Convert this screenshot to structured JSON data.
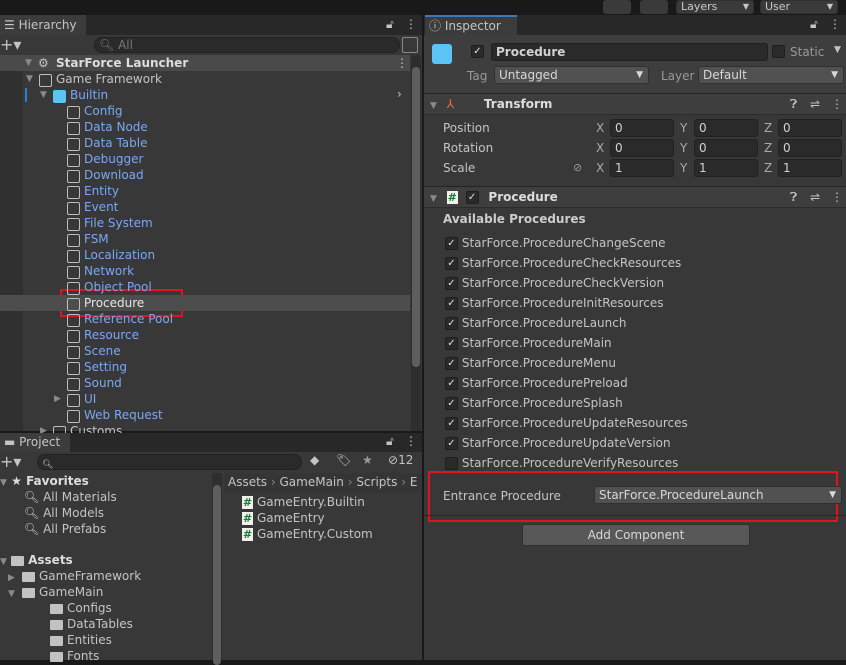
{
  "toolbar": {
    "layers": "Layers",
    "layout": "User"
  },
  "hierarchy": {
    "tab": "Hierarchy",
    "search_placeholder": "All",
    "root": "StarForce Launcher",
    "items": [
      {
        "label": "Game Framework",
        "depth": 1,
        "blue": false,
        "expanded": true
      },
      {
        "label": "Builtin",
        "depth": 2,
        "blue": true,
        "expanded": true
      },
      {
        "label": "Config",
        "depth": 3,
        "blue": true
      },
      {
        "label": "Data Node",
        "depth": 3,
        "blue": true
      },
      {
        "label": "Data Table",
        "depth": 3,
        "blue": true
      },
      {
        "label": "Debugger",
        "depth": 3,
        "blue": true
      },
      {
        "label": "Download",
        "depth": 3,
        "blue": true
      },
      {
        "label": "Entity",
        "depth": 3,
        "blue": true
      },
      {
        "label": "Event",
        "depth": 3,
        "blue": true
      },
      {
        "label": "File System",
        "depth": 3,
        "blue": true
      },
      {
        "label": "FSM",
        "depth": 3,
        "blue": true
      },
      {
        "label": "Localization",
        "depth": 3,
        "blue": true
      },
      {
        "label": "Network",
        "depth": 3,
        "blue": true
      },
      {
        "label": "Object Pool",
        "depth": 3,
        "blue": true
      },
      {
        "label": "Procedure",
        "depth": 3,
        "blue": false,
        "selected": true
      },
      {
        "label": "Reference Pool",
        "depth": 3,
        "blue": true
      },
      {
        "label": "Resource",
        "depth": 3,
        "blue": true
      },
      {
        "label": "Scene",
        "depth": 3,
        "blue": true
      },
      {
        "label": "Setting",
        "depth": 3,
        "blue": true
      },
      {
        "label": "Sound",
        "depth": 3,
        "blue": true
      },
      {
        "label": "UI",
        "depth": 3,
        "blue": true,
        "collapsed": true
      },
      {
        "label": "Web Request",
        "depth": 3,
        "blue": true
      },
      {
        "label": "Customs",
        "depth": 2,
        "blue": false,
        "collapsed": true
      }
    ]
  },
  "project": {
    "tab": "Project",
    "hidden_count": "12",
    "favorites": {
      "label": "Favorites",
      "items": [
        "All Materials",
        "All Models",
        "All Prefabs"
      ]
    },
    "assets": {
      "label": "Assets",
      "items": [
        {
          "label": "GameFramework",
          "depth": 1,
          "arrow": "right"
        },
        {
          "label": "GameMain",
          "depth": 1,
          "arrow": "down"
        },
        {
          "label": "Configs",
          "depth": 2
        },
        {
          "label": "DataTables",
          "depth": 2
        },
        {
          "label": "Entities",
          "depth": 2
        },
        {
          "label": "Fonts",
          "depth": 2
        }
      ]
    },
    "breadcrumb": [
      "Assets",
      "GameMain",
      "Scripts",
      "E"
    ],
    "files": [
      "GameEntry.Builtin",
      "GameEntry",
      "GameEntry.Custom"
    ]
  },
  "inspector": {
    "tab": "Inspector",
    "object_name": "Procedure",
    "static_label": "Static",
    "tag_label": "Tag",
    "tag_value": "Untagged",
    "layer_label": "Layer",
    "layer_value": "Default",
    "transform": {
      "title": "Transform",
      "rows": [
        {
          "label": "Position",
          "x": "0",
          "y": "0",
          "z": "0"
        },
        {
          "label": "Rotation",
          "x": "0",
          "y": "0",
          "z": "0"
        },
        {
          "label": "Scale",
          "x": "1",
          "y": "1",
          "z": "1"
        }
      ]
    },
    "procedure": {
      "title": "Procedure",
      "available_label": "Available Procedures",
      "items": [
        {
          "name": "StarForce.ProcedureChangeScene",
          "checked": true
        },
        {
          "name": "StarForce.ProcedureCheckResources",
          "checked": true
        },
        {
          "name": "StarForce.ProcedureCheckVersion",
          "checked": true
        },
        {
          "name": "StarForce.ProcedureInitResources",
          "checked": true
        },
        {
          "name": "StarForce.ProcedureLaunch",
          "checked": true
        },
        {
          "name": "StarForce.ProcedureMain",
          "checked": true
        },
        {
          "name": "StarForce.ProcedureMenu",
          "checked": true
        },
        {
          "name": "StarForce.ProcedurePreload",
          "checked": true
        },
        {
          "name": "StarForce.ProcedureSplash",
          "checked": true
        },
        {
          "name": "StarForce.ProcedureUpdateResources",
          "checked": true
        },
        {
          "name": "StarForce.ProcedureUpdateVersion",
          "checked": true
        },
        {
          "name": "StarForce.ProcedureVerifyResources",
          "checked": false
        }
      ],
      "entrance_label": "Entrance Procedure",
      "entrance_value": "StarForce.ProcedureLaunch"
    },
    "add_component": "Add Component"
  },
  "colors": {
    "highlight": "#e0141e",
    "prefab_text": "#7aa8f0",
    "selected_row": "#4d4d4d"
  }
}
